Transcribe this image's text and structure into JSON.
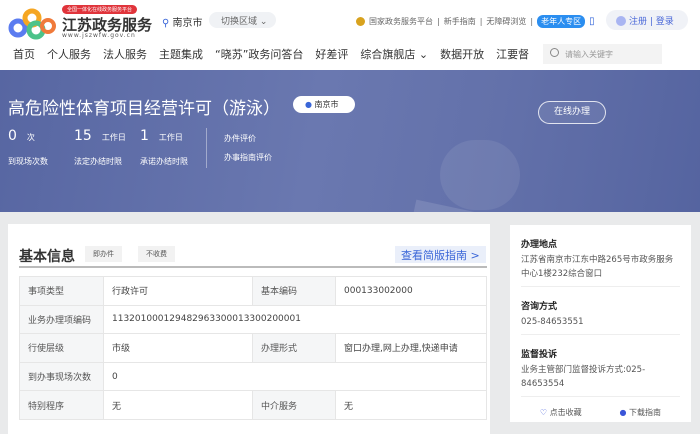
{
  "header": {
    "slogan": "全国一体化在线政务服务平台",
    "brand": "江苏政务服务",
    "url": "www.jszwfw.gov.cn",
    "city": "南京市",
    "switch_region": "切换区域",
    "national_platform": "国家政务服务平台",
    "newbie_guide": "新手指南",
    "accessible": "无障碍浏览",
    "elder_zone": "老年人专区",
    "register": "注册",
    "login": "登录"
  },
  "nav": [
    "首页",
    "个人服务",
    "法人服务",
    "主题集成",
    "“晓苏”政务问答台",
    "好差评",
    "综合旗舰店 ⌄",
    "数据开放",
    "江要督"
  ],
  "search": {
    "placeholder": "请输入关键字"
  },
  "banner": {
    "title": "高危险性体育项目经营许可（游泳）",
    "city": "南京市",
    "stats": [
      {
        "value": "0",
        "unit": "次",
        "label": "到现场次数"
      },
      {
        "value": "15",
        "unit": "工作日",
        "label": "法定办结时限"
      },
      {
        "value": "1",
        "unit": "工作日",
        "label": "承诺办结时限"
      }
    ],
    "eval1": "办件评价",
    "eval2": "办事指南评价",
    "online_button": "在线办理"
  },
  "basic": {
    "title": "基本信息",
    "tags": [
      "即办件",
      "不收费"
    ],
    "guide_link": "查看简版指南 >",
    "rows": [
      [
        "事项类型",
        "行政许可",
        "基本编码",
        "000133002000"
      ],
      [
        "业务办理项编码",
        "11320100012948296330001330020000 1"
      ],
      [
        "行使层级",
        "市级",
        "办理形式",
        "窗口办理,网上办理,快递申请"
      ],
      [
        "到办事现场次数",
        "0"
      ],
      [
        "特别程序",
        "无",
        "中介服务",
        "无"
      ]
    ]
  },
  "side": {
    "location_title": "办理地点",
    "location": "江苏省南京市江东中路265号市政务服务中心1楼232综合窗口",
    "consult_title": "咨询方式",
    "consult": "025-84653551",
    "supervise_title": "监督投诉",
    "supervise": "业务主管部门监督投诉方式:025-84653554",
    "favorite": "点击收藏",
    "download": "下载指南"
  }
}
